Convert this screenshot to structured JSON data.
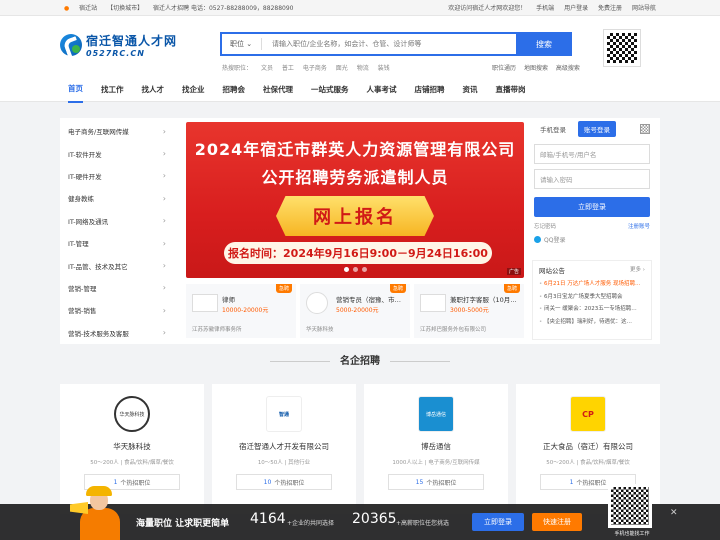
{
  "topbar": {
    "city": "宿迁站",
    "switch": "【切换城市】",
    "hotline": "宿迁人才招聘 电话：0527-88288009，88288090",
    "welcome": "欢迎访问宿迁人才网欢迎您！",
    "mobile": "手机端",
    "user_login": "用户登录",
    "free_register": "免费注册",
    "site_nav": "网站导航"
  },
  "logo": {
    "cn": "宿迁智通人才网",
    "en": "0527RC.CN"
  },
  "search": {
    "type": "职位",
    "placeholder": "请输入职位/企业名称，如会计、仓管、设计师等",
    "button": "搜索"
  },
  "hot": {
    "label": "热搜职位：",
    "items": [
      "文员",
      "普工",
      "电子商务",
      "面光",
      "物流",
      "装钱"
    ]
  },
  "quick": [
    "职位通历",
    "地图搜索",
    "高级搜索"
  ],
  "nav": [
    "首页",
    "找工作",
    "找人才",
    "找企业",
    "招聘会",
    "社保代理",
    "一站式服务",
    "人事考试",
    "店铺招聘",
    "资讯",
    "直播带岗"
  ],
  "categories": [
    "电子商务/互联网传媒",
    "IT-软件开发",
    "IT-硬件开发",
    "健身教练",
    "IT-网络及通讯",
    "IT-管理",
    "IT-品管、技术及其它",
    "营销-管理",
    "营销-销售",
    "营销-技术服务及客服"
  ],
  "banner": {
    "line1": "2024年宿迁市群英人力资源管理有限公司",
    "line2": "公开招聘劳务派遣制人员",
    "line3": "网上报名",
    "line4": "报名时间：2024年9月16日9:00－9月24日16:00",
    "ad": "广告"
  },
  "jobcards": [
    {
      "tag": "急聘",
      "title": "律师",
      "salary": "10000-20000元",
      "company": "江苏苏徽律师事务所"
    },
    {
      "tag": "急聘",
      "title": "营销专员（宿豫、市…",
      "salary": "5000-20000元",
      "company": "华天脉科技"
    },
    {
      "tag": "急聘",
      "title": "兼职打字客服（10月…",
      "salary": "3000-5000元",
      "company": "江苏邦巴服务外包有限公司"
    }
  ],
  "login": {
    "tab1": "手机登录",
    "tab2": "账号登录",
    "user_ph": "邮箱/手机号/用户名",
    "pwd_ph": "请输入密码",
    "button": "立即登录",
    "forgot": "忘记密码",
    "register": "注册账号",
    "qq": "QQ登录"
  },
  "news": {
    "title": "网站公告",
    "more": "更多 ›",
    "items": [
      {
        "text": "6月21日 万达广场人才服务 现场招聘…",
        "hl": true
      },
      {
        "text": "6月3日宝龙广场夏季大型招聘会",
        "hl": false
      },
      {
        "text": "闭关一 缓聚会：2023五一专场招聘…",
        "hl": false
      },
      {
        "text": "【央企招聘】瑞利好，待遇优：这…",
        "hl": false
      }
    ]
  },
  "section_title": "名企招聘",
  "companies": [
    {
      "name": "华天脉科技",
      "info": "50～200人 | 食品/饮料/烟草/餐饮",
      "jobs": "1",
      "jobs_label": "个热招职位",
      "logo": "华天脉科技"
    },
    {
      "name": "宿迁智通人才开发有限公司",
      "info": "10～50人 | 其他行业",
      "jobs": "10",
      "jobs_label": "个热招职位",
      "logo": "智通"
    },
    {
      "name": "博岳通信",
      "info": "1000人以上 | 电子商务/互联网传媒",
      "jobs": "15",
      "jobs_label": "个热招职位",
      "logo": "博岳通信"
    },
    {
      "name": "正大食品（宿迁）有限公司",
      "info": "50～200人 | 食品/饮料/烟草/餐饮",
      "jobs": "1",
      "jobs_label": "个热招职位",
      "logo": "CP"
    }
  ],
  "bottombar": {
    "slogan": "海量职位 让求职更简单",
    "num1": "4164",
    "t1": "+企业的共同选择",
    "num2": "20365",
    "t2": "+高薪职位任您挑选",
    "btn1": "立即登录",
    "btn2": "快速注册",
    "qr_text": "手机也能找工作"
  }
}
